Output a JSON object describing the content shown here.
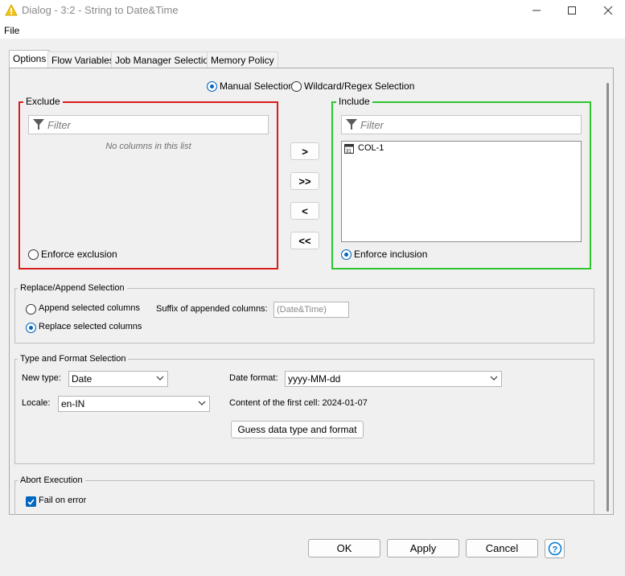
{
  "window": {
    "title": "Dialog - 3:2 - String to Date&Time",
    "icon": "warning-triangle-icon",
    "accent": "#0067c0"
  },
  "menu": {
    "file": "File"
  },
  "tabs": [
    {
      "label": "Options",
      "active": true
    },
    {
      "label": "Flow Variables"
    },
    {
      "label": "Job Manager Selection"
    },
    {
      "label": "Memory Policy"
    }
  ],
  "selection_mode": {
    "manual": "Manual Selection",
    "wildcard": "Wildcard/Regex Selection",
    "selected": "manual"
  },
  "exclude": {
    "title": "Exclude",
    "filter_placeholder": "Filter",
    "empty_text": "No columns in this list",
    "enforce_label": "Enforce exclusion",
    "border_color": "#d91b1b"
  },
  "include": {
    "title": "Include",
    "filter_placeholder": "Filter",
    "columns": [
      "COL-1"
    ],
    "column_icon": "calendar-icon",
    "enforce_label": "Enforce inclusion",
    "border_color": "#2ec52e"
  },
  "move_buttons": [
    ">",
    ">>",
    "<",
    "<<"
  ],
  "replace_append": {
    "title": "Replace/Append Selection",
    "append_label": "Append selected columns",
    "replace_label": "Replace selected columns",
    "suffix_label": "Suffix of appended columns:",
    "suffix_value": "(Date&Time)",
    "selected": "replace"
  },
  "type_format": {
    "title": "Type and Format Selection",
    "new_type_label": "New type:",
    "new_type_value": "Date",
    "date_format_label": "Date format:",
    "date_format_value": "yyyy-MM-dd",
    "locale_label": "Locale:",
    "locale_value": "en-IN",
    "first_cell_label": "Content of the first cell: 2024-01-07",
    "guess_button": "Guess data type and format"
  },
  "abort": {
    "title": "Abort Execution",
    "fail_label": "Fail on error",
    "fail_checked": true
  },
  "footer": {
    "ok": "OK",
    "apply": "Apply",
    "cancel": "Cancel",
    "help_icon": "help-icon"
  }
}
